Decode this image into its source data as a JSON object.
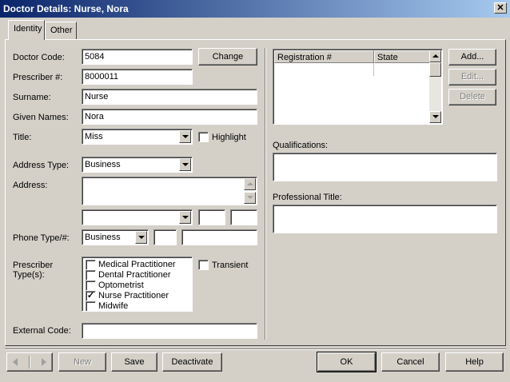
{
  "window": {
    "title": "Doctor Details: Nurse, Nora",
    "close_glyph": "✕"
  },
  "tabs": [
    {
      "label": "Identity"
    },
    {
      "label": "Other"
    }
  ],
  "form": {
    "doctor_code": {
      "label": "Doctor Code:",
      "value": "5084"
    },
    "prescriber_no": {
      "label": "Prescriber #:",
      "value": "8000011"
    },
    "surname": {
      "label": "Surname:",
      "value": "Nurse"
    },
    "given_names": {
      "label": "Given Names:",
      "value": "Nora"
    },
    "title": {
      "label": "Title:",
      "value": "Miss"
    },
    "highlight": {
      "label": "Highlight",
      "checked": false
    },
    "address_type": {
      "label": "Address Type:",
      "value": "Business"
    },
    "address": {
      "label": "Address:",
      "value": ""
    },
    "suburb": {
      "value": ""
    },
    "state": {
      "value": ""
    },
    "postcode": {
      "value": ""
    },
    "phone_type": {
      "label": "Phone Type/#:",
      "value": "Business"
    },
    "phone_area": {
      "value": ""
    },
    "phone_number": {
      "value": ""
    },
    "prescriber_types": {
      "label_line1": "Prescriber",
      "label_line2": "Type(s):",
      "items": [
        {
          "label": "Medical Practitioner",
          "checked": false
        },
        {
          "label": "Dental Practitioner",
          "checked": false
        },
        {
          "label": "Optometrist",
          "checked": false
        },
        {
          "label": "Nurse Practitioner",
          "checked": true
        },
        {
          "label": "Midwife",
          "checked": false
        }
      ]
    },
    "transient": {
      "label": "Transient",
      "checked": false
    },
    "external_code": {
      "label": "External Code:",
      "value": ""
    },
    "change_button": "Change"
  },
  "registrations": {
    "columns": [
      "Registration #",
      "State"
    ],
    "rows": [],
    "add_button": "Add...",
    "edit_button": "Edit...",
    "delete_button": "Delete"
  },
  "qualifications": {
    "label": "Qualifications:",
    "value": ""
  },
  "professional_title": {
    "label": "Professional Title:",
    "value": ""
  },
  "bottom_buttons": {
    "new": "New",
    "save": "Save",
    "deactivate": "Deactivate",
    "ok": "OK",
    "cancel": "Cancel",
    "help": "Help"
  },
  "colors": {
    "titlebar_start": "#0a246a",
    "titlebar_end": "#a6caf0",
    "face": "#d4d0c8"
  }
}
